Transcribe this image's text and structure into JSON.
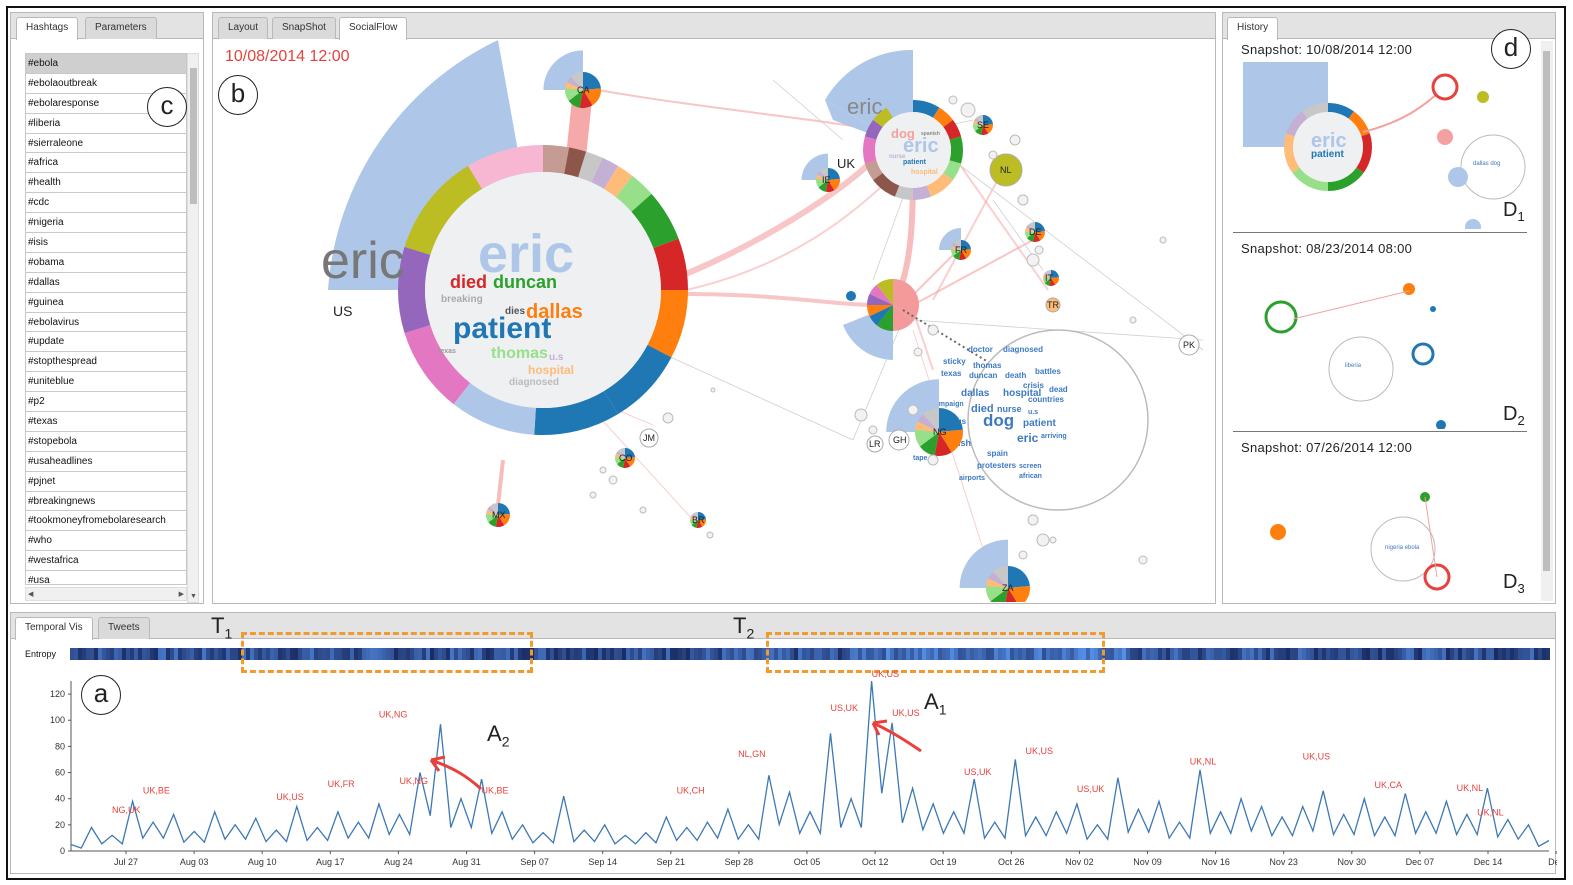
{
  "hashtags_panel": {
    "tabs": [
      "Hashtags",
      "Parameters"
    ],
    "items": [
      "#ebola",
      "#ebolaoutbreak",
      "#ebolaresponse",
      "#liberia",
      "#sierraleone",
      "#africa",
      "#health",
      "#cdc",
      "#nigeria",
      "#isis",
      "#obama",
      "#dallas",
      "#guinea",
      "#ebolavirus",
      "#update",
      "#stopthespread",
      "#uniteblue",
      "#p2",
      "#texas",
      "#stopebola",
      "#usaheadlines",
      "#pjnet",
      "#breakingnews",
      "#tookmoneyfromebolaresearch",
      "#who",
      "#westafrica",
      "#usa"
    ],
    "marker": "c"
  },
  "main_panel": {
    "tabs": [
      "Layout",
      "SnapShot",
      "SocialFlow"
    ],
    "timestamp": "10/08/2014 12:00",
    "marker": "b",
    "us_node": {
      "label": "US",
      "petal_word": "eric",
      "words": [
        "eric",
        "died",
        "duncan",
        "breaking",
        "dies",
        "dallas",
        "patient",
        "thomas",
        "texas",
        "u.s",
        "hospital",
        "diagnosed"
      ]
    },
    "uk_node": {
      "label": "UK",
      "petal_word": "eric",
      "words": [
        "dog",
        "eric",
        "patient",
        "nurse",
        "spanish",
        "dallas",
        "duncan",
        "hospital",
        "spain"
      ]
    },
    "es_cloud_words": [
      "doctor",
      "diagnosed",
      "sticky",
      "thomas",
      "texas",
      "duncan",
      "death",
      "battles",
      "crisis",
      "dead",
      "dallas",
      "hospital",
      "countries",
      "campaign",
      "died",
      "nurse",
      "u.s",
      "virus",
      "dog",
      "patient",
      "arriving",
      "eric",
      "spanish",
      "spain",
      "tape",
      "protesters",
      "screen",
      "airports",
      "african"
    ],
    "country_nodes": [
      "CA",
      "SE",
      "IE",
      "NL",
      "FR",
      "DE",
      "IT",
      "TR",
      "ES",
      "PK",
      "NG",
      "LR",
      "GH",
      "JM",
      "CO",
      "MX",
      "BR",
      "ZA"
    ]
  },
  "history_panel": {
    "tab": "History",
    "marker": "d",
    "snapshots": [
      {
        "title": "Snapshot: 10/08/2014 12:00",
        "label": "D",
        "index": "1"
      },
      {
        "title": "Snapshot: 08/23/2014 08:00",
        "label": "D",
        "index": "2"
      },
      {
        "title": "Snapshot: 07/26/2014 12:00",
        "label": "D",
        "index": "3"
      }
    ]
  },
  "temporal_panel": {
    "tabs": [
      "Temporal Vis",
      "Tweets"
    ],
    "marker": "a",
    "entropy_label": "Entropy",
    "t1": {
      "label": "T",
      "index": "1"
    },
    "t2": {
      "label": "T",
      "index": "2"
    },
    "a1": {
      "label": "A",
      "index": "1"
    },
    "a2": {
      "label": "A",
      "index": "2"
    }
  },
  "chart_data": {
    "type": "line",
    "title": "",
    "ylim": [
      0,
      130
    ],
    "yticks": [
      0,
      20,
      40,
      60,
      80,
      100,
      120
    ],
    "x_tick_labels": [
      "Jul 27",
      "Aug 03",
      "Aug 10",
      "Aug 17",
      "Aug 24",
      "Aug 31",
      "Sep 07",
      "Sep 14",
      "Sep 21",
      "Sep 28",
      "Oct 05",
      "Oct 12",
      "Oct 19",
      "Oct 26",
      "Nov 02",
      "Nov 09",
      "Nov 16",
      "Nov 23",
      "Nov 30",
      "Dec 07",
      "Dec 14",
      "Dec"
    ],
    "series_color": "#3d78b5",
    "sample_days": [
      0,
      2,
      4,
      6,
      8,
      10,
      12,
      14,
      16,
      18,
      20,
      22,
      24,
      26,
      28,
      30,
      32,
      34,
      36,
      38,
      40,
      42,
      44,
      46,
      48,
      50,
      52,
      54,
      56,
      58,
      60,
      62,
      64,
      66,
      68,
      70,
      72,
      74,
      76,
      78,
      80,
      82,
      84,
      86,
      88,
      90,
      92,
      94,
      96,
      98,
      100,
      102,
      104,
      106,
      108,
      110,
      112,
      114,
      116,
      118,
      120,
      122,
      124,
      126,
      128,
      130,
      132,
      134,
      136,
      138,
      140,
      142,
      144
    ],
    "values": [
      5,
      18,
      12,
      38,
      22,
      28,
      15,
      30,
      20,
      25,
      16,
      34,
      18,
      30,
      22,
      36,
      28,
      60,
      97,
      40,
      55,
      30,
      20,
      14,
      42,
      16,
      20,
      12,
      14,
      26,
      18,
      22,
      32,
      20,
      58,
      45,
      30,
      90,
      40,
      130,
      98,
      48,
      36,
      30,
      55,
      22,
      70,
      26,
      30,
      36,
      20,
      56,
      32,
      38,
      22,
      62,
      30,
      40,
      34,
      26,
      34,
      46,
      28,
      40,
      26,
      44,
      30,
      38,
      28,
      48,
      24,
      20,
      8
    ],
    "annotations": [
      {
        "text": "NG,UK",
        "day": 4,
        "value": 26
      },
      {
        "text": "UK,BE",
        "day": 7,
        "value": 41
      },
      {
        "text": "UK,US",
        "day": 20,
        "value": 36
      },
      {
        "text": "UK,FR",
        "day": 25,
        "value": 46
      },
      {
        "text": "UK,NG",
        "day": 30,
        "value": 99
      },
      {
        "text": "UK,NG",
        "day": 32,
        "value": 48
      },
      {
        "text": "UK,BE",
        "day": 40,
        "value": 41
      },
      {
        "text": "UK,CH",
        "day": 59,
        "value": 41
      },
      {
        "text": "NL,GN",
        "day": 65,
        "value": 69
      },
      {
        "text": "US,UK",
        "day": 74,
        "value": 104
      },
      {
        "text": "UK,US",
        "day": 78,
        "value": 130
      },
      {
        "text": "UK,US",
        "day": 80,
        "value": 100
      },
      {
        "text": "US,UK",
        "day": 87,
        "value": 55
      },
      {
        "text": "UK,US",
        "day": 93,
        "value": 71
      },
      {
        "text": "US,UK",
        "day": 98,
        "value": 42
      },
      {
        "text": "UK,NL",
        "day": 109,
        "value": 63
      },
      {
        "text": "UK,US",
        "day": 120,
        "value": 67
      },
      {
        "text": "UK,CA",
        "day": 127,
        "value": 45
      },
      {
        "text": "UK,NL",
        "day": 135,
        "value": 43
      },
      {
        "text": "UK,NL",
        "day": 137,
        "value": 24
      }
    ]
  },
  "colors": {
    "accent_red": "#e8413c",
    "petal_blue": "#aec7e8",
    "orange_box": "#f39a2c",
    "line_blue": "#3d78b5"
  }
}
